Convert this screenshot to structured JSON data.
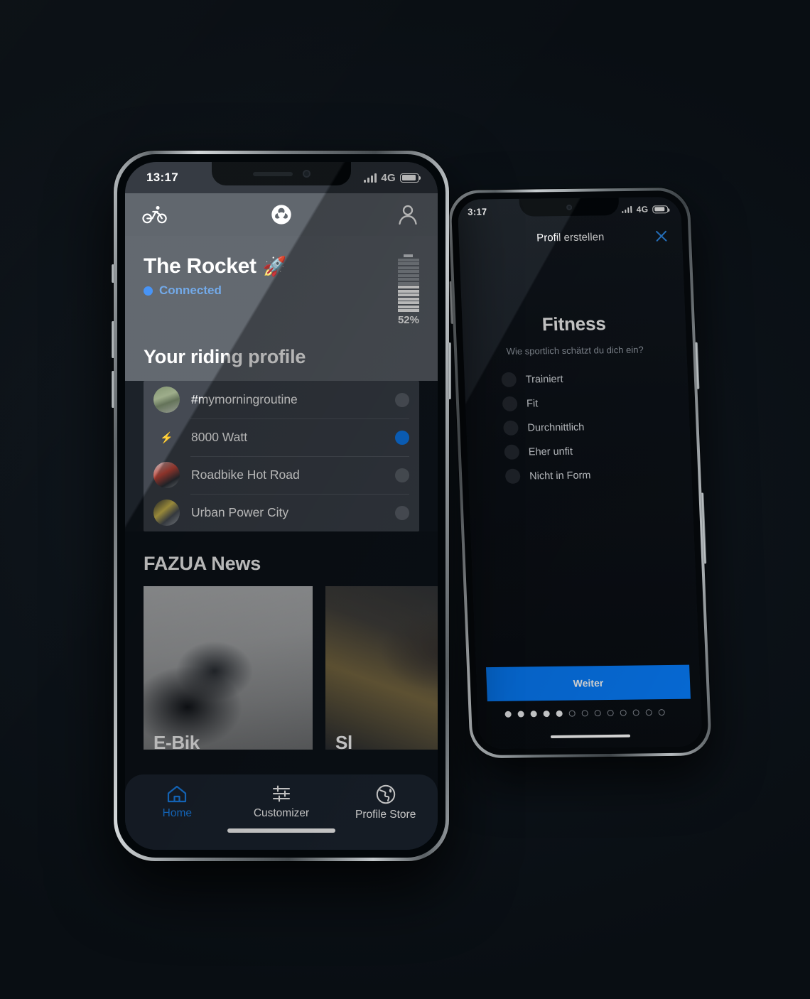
{
  "background_color": "#0b1117",
  "accent_blue": "#077dfc",
  "left_phone": {
    "status_bar": {
      "time": "13:17",
      "network": "4G",
      "signal_icon": "signal-bars-icon",
      "battery_icon": "battery-icon"
    },
    "top_nav": {
      "left_icon": "cyclist-icon",
      "center_icon": "fazua-logo-icon",
      "right_icon": "user-profile-icon"
    },
    "hero": {
      "device_name": "The Rocket",
      "device_emoji": "🚀",
      "connection_status": "Connected",
      "battery_percent": "52%",
      "battery_value": 52
    },
    "riding_profile": {
      "section_title": "Your riding profile",
      "items": [
        {
          "label": "#mymorningroutine",
          "icon": "profile-thumbnail-road-cyclist",
          "selected": false
        },
        {
          "label": "8000 Watt",
          "icon": "lightning-bolt-icon",
          "selected": true
        },
        {
          "label": "Roadbike Hot Road",
          "icon": "profile-thumbnail-roadbike",
          "selected": false
        },
        {
          "label": "Urban Power City",
          "icon": "profile-thumbnail-urban",
          "selected": false
        }
      ]
    },
    "news": {
      "section_title": "FAZUA News",
      "cards": [
        {
          "title": "E-Bik",
          "image": "mtb-rider-photo"
        },
        {
          "title": "Sl",
          "image": "glove-bike-photo"
        }
      ]
    },
    "tab_bar": [
      {
        "label": "Home",
        "icon": "home-icon",
        "active": true
      },
      {
        "label": "Customizer",
        "icon": "sliders-icon",
        "active": false
      },
      {
        "label": "Profile Store",
        "icon": "globe-icon",
        "active": false
      }
    ]
  },
  "right_phone": {
    "status_bar": {
      "time": "3:17",
      "network": "4G",
      "signal_icon": "signal-bars-icon",
      "battery_icon": "battery-icon"
    },
    "header": {
      "title": "Profil erstellen",
      "close_icon": "close-x-icon"
    },
    "content": {
      "heading": "Fitness",
      "subheading": "Wie sportlich schätzt du dich ein?",
      "options": [
        {
          "label": "Trainiert",
          "selected": false
        },
        {
          "label": "Fit",
          "selected": false
        },
        {
          "label": "Durchnittlich",
          "selected": false
        },
        {
          "label": "Eher unfit",
          "selected": false
        },
        {
          "label": "Nicht in Form",
          "selected": false
        }
      ]
    },
    "cta": {
      "label": "Weiter"
    },
    "pagination": {
      "total": 13,
      "completed": 5
    }
  }
}
